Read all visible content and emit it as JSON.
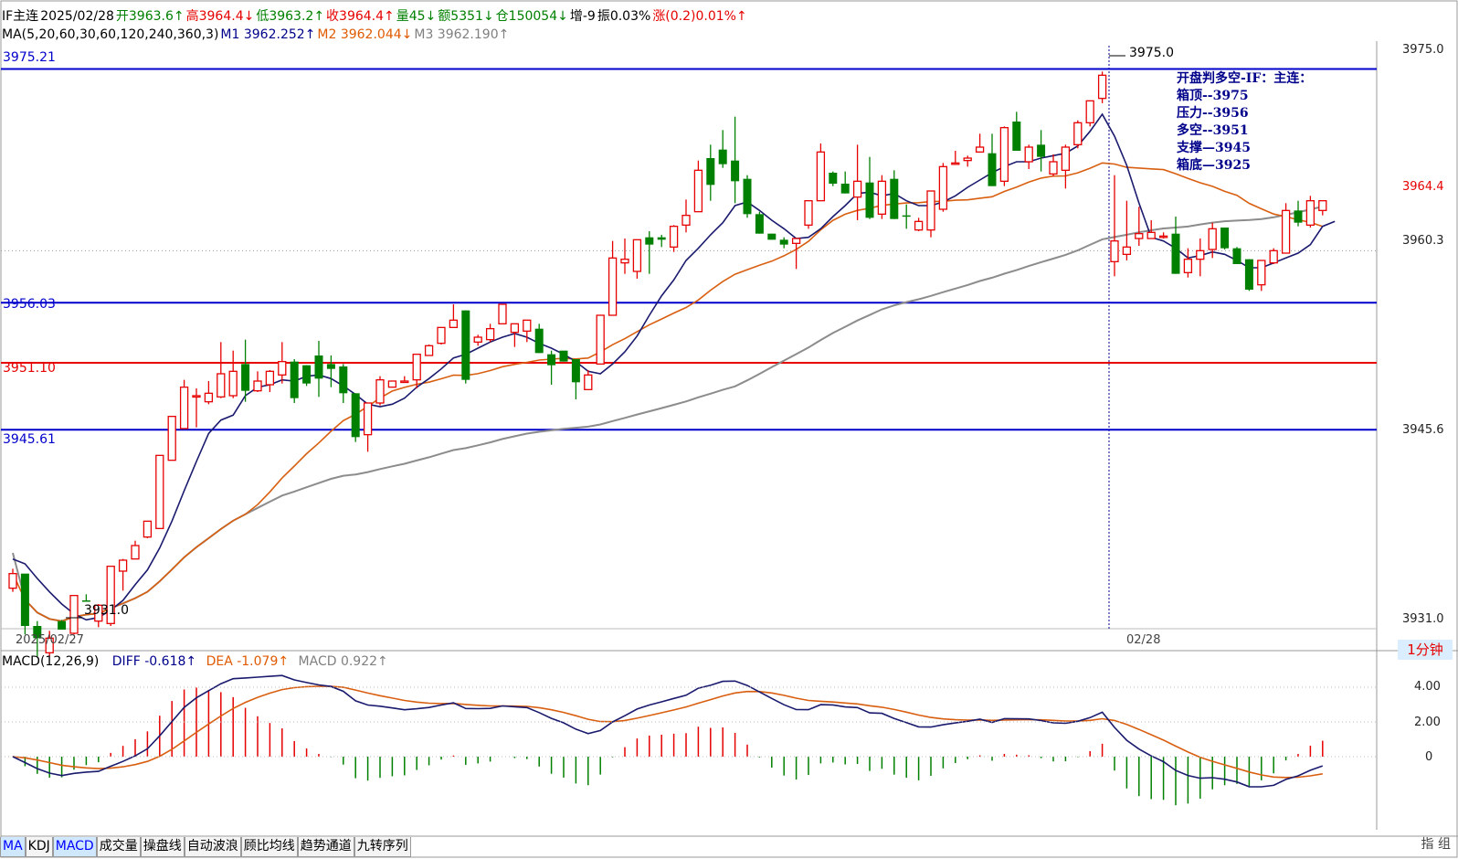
{
  "header": {
    "row1": [
      {
        "text": "IF主连",
        "color": "blk"
      },
      {
        "text": "2025/02/28",
        "color": "blk"
      },
      {
        "text": "开3963.6↑",
        "color": "green"
      },
      {
        "text": "高3964.4↓",
        "color": "red"
      },
      {
        "text": "低3963.2↑",
        "color": "green"
      },
      {
        "text": "收3964.4↑",
        "color": "red"
      },
      {
        "text": "量45↓",
        "color": "green"
      },
      {
        "text": "额5351↓",
        "color": "green"
      },
      {
        "text": "仓150054↓",
        "color": "green"
      },
      {
        "text": "增-9",
        "color": "blk"
      },
      {
        "text": "振0.03%",
        "color": "blk"
      },
      {
        "text": "涨(0.2)0.01%↑",
        "color": "red"
      }
    ],
    "row2": [
      {
        "text": "MA(5,20,60,30,60,120,240,360,3)",
        "color": "blk"
      },
      {
        "text": "M1 3962.252↑",
        "color": "navy"
      },
      {
        "text": "M2 3962.044↓",
        "color": "orange"
      },
      {
        "text": "M3 3962.190↑",
        "color": "gray"
      }
    ]
  },
  "price_levels": {
    "box_top": "3975.21",
    "pressure": "3956.03",
    "bull_bear": "3951.10",
    "support": "3945.61"
  },
  "annotations": {
    "peak_label": "3975.0",
    "low_label": "3931.0",
    "lines": [
      "开盘判多空-IF：主连：",
      "箱顶--3975",
      "压力--3956",
      "多空--3951",
      "支撑—3945",
      "箱底—3925"
    ]
  },
  "right_axis": {
    "labels": [
      "3975.0",
      "3964.4",
      "3960.3",
      "3945.6",
      "3931.0"
    ]
  },
  "dates": {
    "left": "2025/02/27",
    "right": "02/28"
  },
  "timeframe": "1分钟",
  "macd": {
    "title": "MACD(12,26,9)",
    "diff": "DIFF -0.618↑",
    "dea": "DEA -1.079↑",
    "macd": "MACD 0.922↑",
    "axis": [
      "4.00",
      "2.00",
      "0"
    ]
  },
  "tabs": [
    "MA",
    "KDJ",
    "MACD",
    "成交量",
    "操盘线",
    "自动波浪",
    "顾比均线",
    "趋势通道",
    "九转序列"
  ],
  "active_tabs": [
    "MA",
    "MACD"
  ],
  "watermark": "指 组",
  "colors": {
    "up": "#e60000",
    "down": "#008000",
    "ma5": "#1a1a6e",
    "ma20": "#d95f10",
    "ma60": "#8c8c8c",
    "level_blue": "#0000cc",
    "level_red": "#e60000"
  },
  "chart_data": {
    "type": "candlestick",
    "y_range": [
      3929.5,
      3977.5
    ],
    "candles": [
      [
        3932.6,
        3933.8,
        3932.3,
        3934.2
      ],
      [
        3933.8,
        3929.5,
        3928.8,
        3931.5
      ],
      [
        3929.5,
        3928.5,
        3927.0,
        3929.9
      ],
      [
        3927.3,
        3928.5,
        3927.0,
        3929.1
      ],
      [
        3929.9,
        3929.2,
        3929.9,
        3930.0
      ],
      [
        3928.9,
        3932.0,
        3928.8,
        3931.9
      ],
      [
        3931.6,
        3931.5,
        3932.1,
        3931.5
      ],
      [
        3929.9,
        3931.2,
        3929.4,
        3931.3
      ],
      [
        3929.7,
        3934.4,
        3929.5,
        3934.4
      ],
      [
        3934.0,
        3934.9,
        3932.4,
        3935.0
      ],
      [
        3935.0,
        3936.1,
        3935.0,
        3936.5
      ],
      [
        3936.8,
        3938.1,
        3936.7,
        3938.1
      ],
      [
        3937.5,
        3943.5,
        3937.5,
        3943.5
      ],
      [
        3943.1,
        3946.7,
        3943.1,
        3946.7
      ],
      [
        3945.7,
        3949.1,
        3945.7,
        3949.7
      ],
      [
        3948.4,
        3948.4,
        3945.8,
        3949.0
      ],
      [
        3947.9,
        3948.6,
        3947.7,
        3949.6
      ],
      [
        3948.3,
        3950.2,
        3948.2,
        3952.8
      ],
      [
        3948.4,
        3950.4,
        3948.2,
        3952.1
      ],
      [
        3951.0,
        3948.8,
        3947.9,
        3953.0
      ],
      [
        3948.8,
        3949.6,
        3948.7,
        3950.4
      ],
      [
        3949.3,
        3950.4,
        3948.7,
        3950.5
      ],
      [
        3950.1,
        3951.2,
        3949.4,
        3952.8
      ],
      [
        3951.2,
        3948.2,
        3947.8,
        3951.4
      ],
      [
        3950.9,
        3949.4,
        3949.2,
        3950.9
      ],
      [
        3951.7,
        3949.8,
        3948.3,
        3952.9
      ],
      [
        3951.0,
        3950.6,
        3949.1,
        3951.7
      ],
      [
        3950.8,
        3948.6,
        3947.8,
        3951.0
      ],
      [
        3948.6,
        3945.0,
        3944.6,
        3948.6
      ],
      [
        3945.2,
        3947.8,
        3943.8,
        3947.8
      ],
      [
        3947.8,
        3949.7,
        3947.6,
        3950.0
      ],
      [
        3949.1,
        3949.6,
        3949.3,
        3949.2
      ],
      [
        3949.6,
        3949.6,
        3949.5,
        3950.0
      ],
      [
        3949.7,
        3951.8,
        3949.0,
        3951.8
      ],
      [
        3951.7,
        3952.5,
        3951.7,
        3952.6
      ],
      [
        3952.7,
        3954.0,
        3952.6,
        3954.0
      ],
      [
        3954.0,
        3954.6,
        3954.0,
        3955.9
      ],
      [
        3955.4,
        3949.7,
        3949.4,
        3955.4
      ],
      [
        3952.8,
        3953.2,
        3952.5,
        3953.4
      ],
      [
        3953.0,
        3953.9,
        3952.8,
        3954.3
      ],
      [
        3954.3,
        3955.9,
        3954.3,
        3955.9
      ],
      [
        3953.6,
        3954.3,
        3952.4,
        3954.3
      ],
      [
        3953.7,
        3954.6,
        3952.8,
        3954.6
      ],
      [
        3953.9,
        3951.9,
        3951.9,
        3954.3
      ],
      [
        3951.8,
        3950.9,
        3949.3,
        3952.1
      ],
      [
        3952.1,
        3951.2,
        3951.2,
        3951.3
      ],
      [
        3951.4,
        3949.5,
        3948.1,
        3951.1
      ],
      [
        3948.9,
        3950.1,
        3948.9,
        3950.5
      ],
      [
        3951.0,
        3955.0,
        3951.0,
        3955.0
      ],
      [
        3955.0,
        3959.7,
        3955.0,
        3961.1
      ],
      [
        3959.3,
        3959.6,
        3958.4,
        3961.3
      ],
      [
        3958.6,
        3961.2,
        3958.0,
        3961.2
      ],
      [
        3961.4,
        3960.8,
        3958.4,
        3961.9
      ],
      [
        3961.4,
        3961.2,
        3960.6,
        3961.6
      ],
      [
        3960.6,
        3962.3,
        3960.2,
        3962.4
      ],
      [
        3962.4,
        3963.2,
        3961.8,
        3964.5
      ],
      [
        3963.5,
        3966.9,
        3963.5,
        3967.7
      ],
      [
        3967.9,
        3965.7,
        3964.4,
        3969.0
      ],
      [
        3968.6,
        3967.4,
        3967.1,
        3970.2
      ],
      [
        3967.7,
        3966.0,
        3964.2,
        3971.3
      ],
      [
        3966.2,
        3963.3,
        3963.0,
        3966.5
      ],
      [
        3963.3,
        3961.7,
        3961.7,
        3963.5
      ],
      [
        3961.7,
        3961.2,
        3961.2,
        3961.7
      ],
      [
        3961.2,
        3960.8,
        3960.5,
        3961.4
      ],
      [
        3960.9,
        3961.3,
        3958.8,
        3961.3
      ],
      [
        3962.4,
        3964.4,
        3962.1,
        3964.4
      ],
      [
        3964.4,
        3968.4,
        3964.4,
        3969.1
      ],
      [
        3966.7,
        3965.8,
        3965.6,
        3966.8
      ],
      [
        3965.8,
        3965.0,
        3965.0,
        3966.8
      ],
      [
        3964.7,
        3966.0,
        3962.8,
        3969.0
      ],
      [
        3965.9,
        3963.0,
        3962.9,
        3968.0
      ],
      [
        3963.3,
        3966.0,
        3962.9,
        3966.5
      ],
      [
        3966.2,
        3962.9,
        3962.9,
        3966.9
      ],
      [
        3963.2,
        3963.1,
        3962.1,
        3964.1
      ],
      [
        3962.0,
        3962.7,
        3961.9,
        3963.0
      ],
      [
        3962.0,
        3965.2,
        3961.4,
        3965.2
      ],
      [
        3963.7,
        3967.2,
        3963.5,
        3967.5
      ],
      [
        3967.4,
        3967.5,
        3967.4,
        3968.5
      ],
      [
        3967.7,
        3967.9,
        3967.2,
        3968.1
      ],
      [
        3968.4,
        3968.8,
        3968.4,
        3969.9
      ],
      [
        3968.3,
        3965.6,
        3965.6,
        3969.9
      ],
      [
        3966.0,
        3970.4,
        3965.6,
        3970.5
      ],
      [
        3970.9,
        3968.5,
        3968.5,
        3971.7
      ],
      [
        3967.6,
        3968.8,
        3967.0,
        3969.0
      ],
      [
        3969.0,
        3968.0,
        3966.8,
        3970.2
      ],
      [
        3966.6,
        3967.6,
        3966.4,
        3968.2
      ],
      [
        3966.9,
        3968.8,
        3965.4,
        3969.0
      ],
      [
        3969.0,
        3970.8,
        3968.7,
        3971.0
      ],
      [
        3970.8,
        3972.6,
        3970.5,
        3972.6
      ],
      [
        3972.8,
        3974.7,
        3972.4,
        3975.0
      ],
      [
        3959.4,
        3961.1,
        3958.2,
        3966.5
      ],
      [
        3960.0,
        3960.6,
        3959.5,
        3964.4
      ],
      [
        3961.3,
        3961.7,
        3960.7,
        3963.9
      ],
      [
        3961.3,
        3961.8,
        3961.3,
        3962.8
      ],
      [
        3961.4,
        3961.5,
        3961.3,
        3961.8
      ],
      [
        3961.7,
        3958.4,
        3958.4,
        3963.1
      ],
      [
        3958.5,
        3959.6,
        3958.1,
        3960.5
      ],
      [
        3959.6,
        3960.3,
        3958.2,
        3961.3
      ],
      [
        3960.4,
        3962.1,
        3959.7,
        3962.6
      ],
      [
        3962.2,
        3960.5,
        3960.4,
        3962.2
      ],
      [
        3960.5,
        3959.2,
        3959.2,
        3960.6
      ],
      [
        3959.6,
        3957.1,
        3957.0,
        3959.6
      ],
      [
        3957.5,
        3959.5,
        3957.0,
        3959.5
      ],
      [
        3959.3,
        3960.3,
        3959.2,
        3960.5
      ],
      [
        3960.1,
        3963.6,
        3960.1,
        3964.2
      ],
      [
        3963.6,
        3962.6,
        3962.3,
        3964.4
      ],
      [
        3962.4,
        3964.4,
        3962.2,
        3964.8
      ],
      [
        3963.6,
        3964.4,
        3963.2,
        3964.4
      ]
    ],
    "ma_m1": [
      3935.0,
      3934.6,
      3933.4,
      3932.3,
      3931.3,
      3930.5,
      3930.0,
      3930.2,
      3930.8,
      3931.6,
      3932.9,
      3934.1,
      3935.9,
      3938.1,
      3940.6,
      3943.0,
      3945.3,
      3946.4,
      3946.8,
      3948.4,
      3949.1,
      3949.3,
      3949.7,
      3949.6,
      3950.0,
      3950.1,
      3949.8,
      3949.2,
      3948.5,
      3947.7,
      3947.5,
      3947.7,
      3948.2,
      3949.1,
      3949.8,
      3950.6,
      3951.5,
      3951.8,
      3952.3,
      3952.8,
      3953.2,
      3953.5,
      3953.2,
      3952.7,
      3952.3,
      3951.8,
      3951.2,
      3950.4,
      3950.2,
      3951.0,
      3952.0,
      3953.3,
      3955.0,
      3956.6,
      3957.9,
      3959.5,
      3960.5,
      3961.6,
      3962.6,
      3964.0,
      3964.3,
      3963.6,
      3962.8,
      3962.1,
      3961.3,
      3961.4,
      3962.1,
      3963.1,
      3964.0,
      3965.0,
      3965.1,
      3964.8,
      3965.0,
      3964.4,
      3964.0,
      3964.0,
      3964.3,
      3964.8,
      3965.5,
      3966.1,
      3966.7,
      3967.2,
      3967.6,
      3967.6,
      3967.9,
      3968.1,
      3968.3,
      3968.9,
      3970.1,
      3971.5,
      3969.7,
      3967.3,
      3964.2,
      3961.4,
      3961.1,
      3960.5,
      3959.7,
      3959.9,
      3960.2,
      3960.0,
      3959.5,
      3958.9,
      3958.9,
      3959.3,
      3959.7,
      3960.1,
      3960.8,
      3962.3,
      3962.7
    ]
  }
}
